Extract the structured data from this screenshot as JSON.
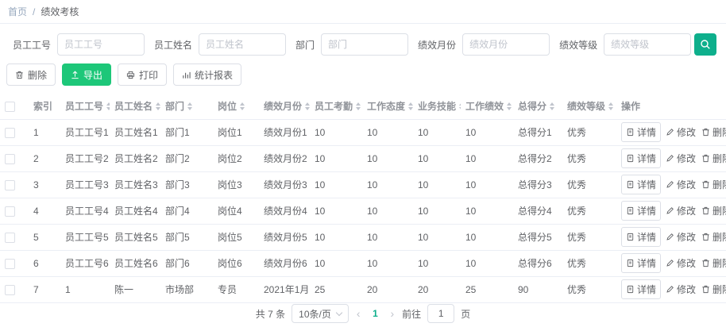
{
  "colors": {
    "primary": "#0eaf8c",
    "success": "#1dc779"
  },
  "breadcrumb": {
    "home": "首页",
    "separator": "/",
    "current": "绩效考核"
  },
  "filters": [
    {
      "label": "员工工号",
      "placeholder": "员工工号"
    },
    {
      "label": "员工姓名",
      "placeholder": "员工姓名"
    },
    {
      "label": "部门",
      "placeholder": "部门"
    },
    {
      "label": "绩效月份",
      "placeholder": "绩效月份"
    },
    {
      "label": "绩效等级",
      "placeholder": "绩效等级"
    }
  ],
  "toolbar": {
    "delete": "删除",
    "export": "导出",
    "print": "打印",
    "report": "统计报表"
  },
  "icons": {
    "search": "search-icon",
    "toolbar_delete": "trash-icon",
    "toolbar_export": "export-icon",
    "toolbar_print": "printer-icon",
    "toolbar_report": "bar-chart-icon",
    "row_detail": "document-icon",
    "row_edit": "pencil-icon",
    "row_delete": "trash-icon",
    "sort": "sort-caret-icon",
    "page_size": "chevron-down-icon",
    "prev": "chevron-left-icon",
    "next": "chevron-right-icon"
  },
  "table": {
    "headers": [
      {
        "label": "索引",
        "sortable": false
      },
      {
        "label": "员工工号",
        "sortable": true
      },
      {
        "label": "员工姓名",
        "sortable": true
      },
      {
        "label": "部门",
        "sortable": true
      },
      {
        "label": "岗位",
        "sortable": true
      },
      {
        "label": "绩效月份",
        "sortable": true
      },
      {
        "label": "员工考勤",
        "sortable": true
      },
      {
        "label": "工作态度",
        "sortable": true
      },
      {
        "label": "业务技能",
        "sortable": true
      },
      {
        "label": "工作绩效",
        "sortable": true
      },
      {
        "label": "总得分",
        "sortable": true
      },
      {
        "label": "绩效等级",
        "sortable": true
      },
      {
        "label": "操作",
        "sortable": false
      }
    ],
    "rows": [
      [
        "1",
        "员工工号1",
        "员工姓名1",
        "部门1",
        "岗位1",
        "绩效月份1",
        "10",
        "10",
        "10",
        "10",
        "总得分1",
        "优秀"
      ],
      [
        "2",
        "员工工号2",
        "员工姓名2",
        "部门2",
        "岗位2",
        "绩效月份2",
        "10",
        "10",
        "10",
        "10",
        "总得分2",
        "优秀"
      ],
      [
        "3",
        "员工工号3",
        "员工姓名3",
        "部门3",
        "岗位3",
        "绩效月份3",
        "10",
        "10",
        "10",
        "10",
        "总得分3",
        "优秀"
      ],
      [
        "4",
        "员工工号4",
        "员工姓名4",
        "部门4",
        "岗位4",
        "绩效月份4",
        "10",
        "10",
        "10",
        "10",
        "总得分4",
        "优秀"
      ],
      [
        "5",
        "员工工号5",
        "员工姓名5",
        "部门5",
        "岗位5",
        "绩效月份5",
        "10",
        "10",
        "10",
        "10",
        "总得分5",
        "优秀"
      ],
      [
        "6",
        "员工工号6",
        "员工姓名6",
        "部门6",
        "岗位6",
        "绩效月份6",
        "10",
        "10",
        "10",
        "10",
        "总得分6",
        "优秀"
      ],
      [
        "7",
        "1",
        "陈一",
        "市场部",
        "专员",
        "2021年1月",
        "25",
        "20",
        "20",
        "25",
        "90",
        "优秀"
      ]
    ],
    "row_actions": {
      "detail": "详情",
      "edit": "修改",
      "delete": "删除"
    }
  },
  "pagination": {
    "total": "共 7 条",
    "page_size": "10条/页",
    "active_page": "1",
    "prev": "‹",
    "next": "›",
    "goto_label": "前往",
    "goto_value": "1",
    "goto_suffix": "页"
  }
}
